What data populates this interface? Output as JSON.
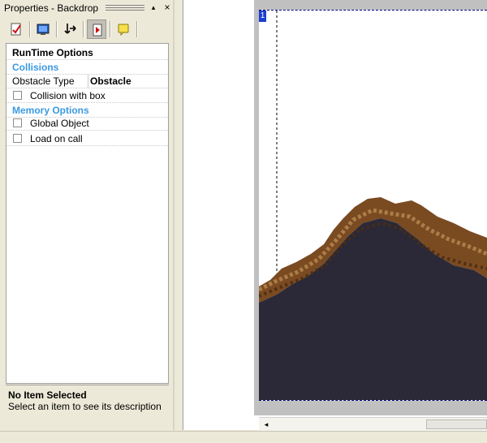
{
  "panel": {
    "title": "Properties - Backdrop",
    "pin_glyph": "▴",
    "close_glyph": "×",
    "toolbar_icons": [
      "checklist-icon",
      "display-icon",
      "move-icon",
      "runtime-icon",
      "comment-icon"
    ]
  },
  "grid": {
    "header": "RunTime Options",
    "collisions_category": "Collisions",
    "obstacle_type_label": "Obstacle Type",
    "obstacle_type_value": "Obstacle",
    "collision_with_box_label": "Collision with box",
    "collision_with_box_checked": false,
    "memory_category": "Memory Options",
    "global_object_label": "Global Object",
    "global_object_checked": false,
    "load_on_call_label": "Load on call",
    "load_on_call_checked": false
  },
  "description": {
    "title": "No Item Selected",
    "text": "Select an item to see its description"
  },
  "editor": {
    "layer_number": "1",
    "scroll_left_glyph": "◂",
    "colors": {
      "ground": "#2b2937",
      "dirt": "#7a4a21",
      "canvas_bg": "#c0c0c0",
      "layer_badge": "#1b3fd0"
    }
  }
}
